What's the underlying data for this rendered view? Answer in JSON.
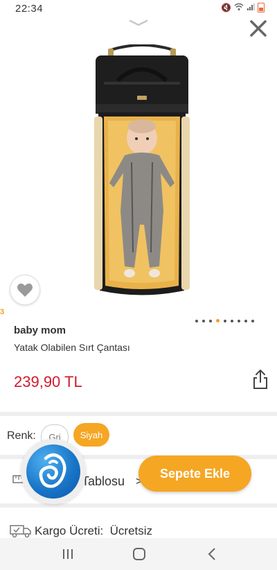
{
  "status_bar": {
    "time": "22:34"
  },
  "product": {
    "brand": "baby mom",
    "name": "Yatak Olabilen Sırt Çantası",
    "price": "239,90 TL",
    "image_index_marker": "3",
    "carousel": {
      "total": 9,
      "active_index": 3
    }
  },
  "options": {
    "color_label": "Renk:",
    "colors": [
      {
        "label": "Gri",
        "selected": false
      },
      {
        "label": "Siyah",
        "selected": true
      }
    ]
  },
  "size_table": {
    "label": "Tablosu"
  },
  "cargo": {
    "label": "Kargo Ücreti:",
    "value": "Ücretsiz"
  },
  "actions": {
    "add_to_cart": "Sepete Ekle"
  },
  "colors": {
    "accent": "#f5a623",
    "price": "#d21a2a"
  },
  "icons": [
    "close-icon",
    "heart-icon",
    "share-icon",
    "ruler-icon",
    "truck-icon",
    "chat-logo-icon",
    "recent-apps-icon",
    "home-icon",
    "back-icon"
  ]
}
